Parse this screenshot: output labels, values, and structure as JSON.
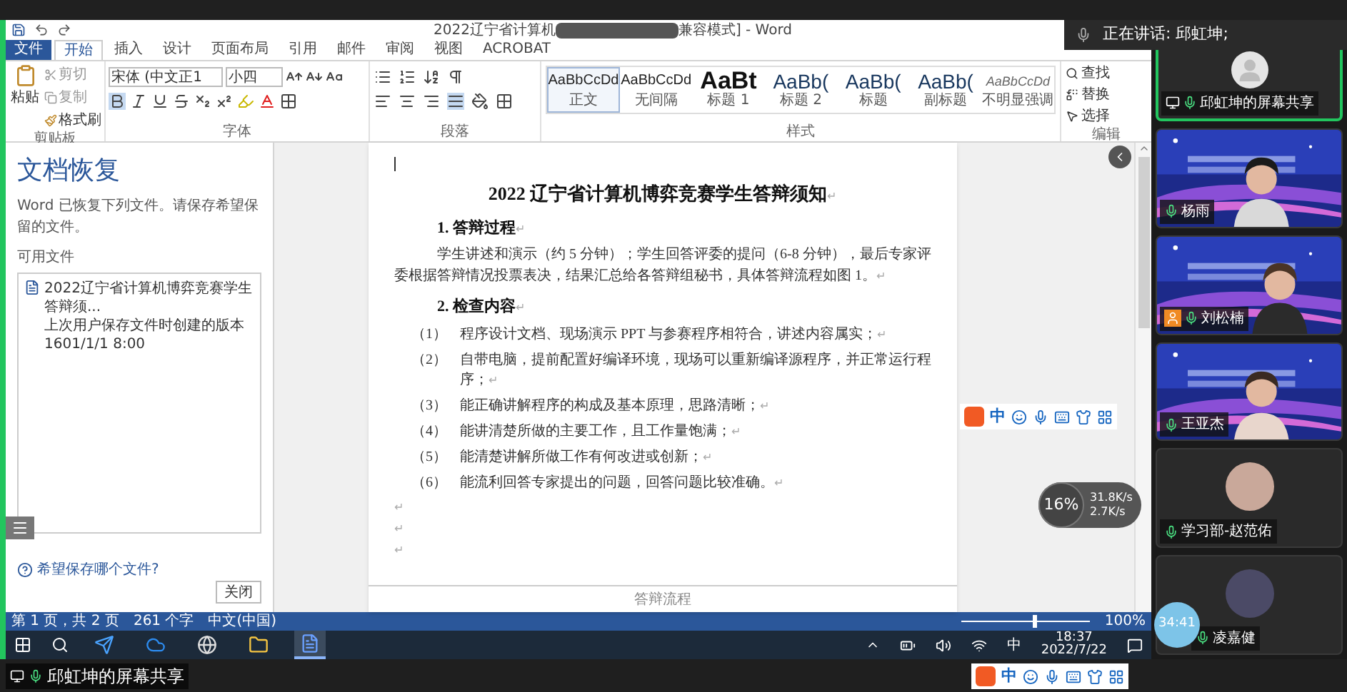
{
  "word": {
    "title_start": "2022辽宁省计算机",
    "title_end": "兼容模式] - Word",
    "tabs": [
      {
        "label": "文件",
        "kind": "file",
        "selected": false
      },
      {
        "label": "开始",
        "kind": "tab",
        "selected": true
      },
      {
        "label": "插入",
        "kind": "tab",
        "selected": false
      },
      {
        "label": "设计",
        "kind": "tab",
        "selected": false
      },
      {
        "label": "页面布局",
        "kind": "tab",
        "selected": false
      },
      {
        "label": "引用",
        "kind": "tab",
        "selected": false
      },
      {
        "label": "邮件",
        "kind": "tab",
        "selected": false
      },
      {
        "label": "审阅",
        "kind": "tab",
        "selected": false
      },
      {
        "label": "视图",
        "kind": "tab",
        "selected": false
      },
      {
        "label": "ACROBAT",
        "kind": "tab",
        "selected": false
      }
    ],
    "clipboard": {
      "paste": "粘贴",
      "cut": "剪切",
      "copy": "复制",
      "format_painter": "格式刷",
      "group": "剪贴板"
    },
    "font": {
      "name": "宋体 (中文正1",
      "size": "小四",
      "group": "字体"
    },
    "paragraph": {
      "group": "段落"
    },
    "styles": {
      "group": "样式",
      "items": [
        {
          "sample": "AaBbCcDd",
          "label": "正文",
          "kind": "body",
          "selected": true
        },
        {
          "sample": "AaBbCcDd",
          "label": "无间隔",
          "kind": "body",
          "selected": false
        },
        {
          "sample": "AaBt",
          "label": "标题 1",
          "kind": "heading",
          "selected": false
        },
        {
          "sample": "AaBb(",
          "label": "标题 2",
          "kind": "subheading",
          "selected": false
        },
        {
          "sample": "AaBb(",
          "label": "标题",
          "kind": "subheading",
          "selected": false
        },
        {
          "sample": "AaBb(",
          "label": "副标题",
          "kind": "subheading",
          "selected": false
        },
        {
          "sample": "AaBbCcDd",
          "label": "不明显强调",
          "kind": "emphasis",
          "selected": false
        }
      ]
    },
    "editing": {
      "group": "编辑",
      "find": "查找",
      "replace": "替换",
      "select": "选择"
    },
    "recovery": {
      "title": "文档恢复",
      "description": "Word 已恢复下列文件。请保存希望保留的文件。",
      "section": "可用文件",
      "file": {
        "name": "2022辽宁省计算机博弈竞赛学生答辩须...",
        "note": "上次用户保存文件时创建的版本",
        "time": "1601/1/1 8:00"
      },
      "help_link": "希望保存哪个文件?",
      "close_button": "关闭"
    },
    "document": {
      "title": "2022 辽宁省计算机博弈竞赛学生答辩须知",
      "end_mark": "↵",
      "sections": [
        {
          "heading": "1. 答辩过程",
          "paragraph": "学生讲述和演示（约 5 分钟）；学生回答评委的提问（6-8 分钟），最后专家评委根据答辩情况投票表决，结果汇总给各答辩组秘书，具体答辩流程如图 1。"
        },
        {
          "heading": "2. 检查内容",
          "items": [
            {
              "number": "（1）",
              "text": "程序设计文档、现场演示 PPT 与参赛程序相符合，讲述内容属实；"
            },
            {
              "number": "（2）",
              "text": "自带电脑，提前配置好编译环境，现场可以重新编译源程序，并正常运行程序；"
            },
            {
              "number": "（3）",
              "text": "能正确讲解程序的构成及基本原理，思路清晰；"
            },
            {
              "number": "（4）",
              "text": "能讲清楚所做的主要工作，且工作量饱满；"
            },
            {
              "number": "（5）",
              "text": "能清楚讲解所做工作有何改进或创新；"
            },
            {
              "number": "（6）",
              "text": "能流利回答专家提出的问题，回答问题比较准确。"
            }
          ]
        }
      ],
      "blank_marks": [
        "↵",
        "↵",
        "↵"
      ],
      "footer": "答辩流程"
    },
    "status": {
      "page": "第 1 页，共 2 页",
      "words": "261 个字",
      "language": "中文(中国)",
      "zoom": "100%",
      "level": 0.55
    },
    "taskbar": {
      "apps": [
        {
          "kind": "bird",
          "selected": false
        },
        {
          "kind": "cloud",
          "selected": false
        },
        {
          "kind": "browser",
          "selected": false
        },
        {
          "kind": "folder",
          "selected": false
        },
        {
          "kind": "word",
          "selected": true
        }
      ],
      "ime": "中",
      "time": "18:37",
      "date": "2022/7/22"
    }
  },
  "meeting": {
    "speaker_banner": "正在讲话: 邱虹坤;",
    "tiles": [
      {
        "kind": "avatar",
        "name": "邱虹坤的屏幕共享",
        "screen_share": true,
        "active": true
      },
      {
        "kind": "video",
        "name": "杨雨",
        "screen_share": false,
        "active": false
      },
      {
        "kind": "video",
        "name": "刘松楠",
        "screen_share": false,
        "active": false
      },
      {
        "kind": "video",
        "name": "王亚杰",
        "screen_share": false,
        "active": false
      },
      {
        "name": "学习部-赵范佑",
        "screen_share": false,
        "active": false
      },
      {
        "name": "凌嘉健",
        "screen_share": false,
        "active": false
      }
    ],
    "share_label": "邱虹坤的屏幕共享",
    "timer": "34:41",
    "network": {
      "percent": "16%",
      "up": "31.8K/s",
      "down": "2.7K/s"
    },
    "ime_toolbars": [
      {
        "label": "中"
      },
      {
        "label": "中"
      }
    ]
  }
}
